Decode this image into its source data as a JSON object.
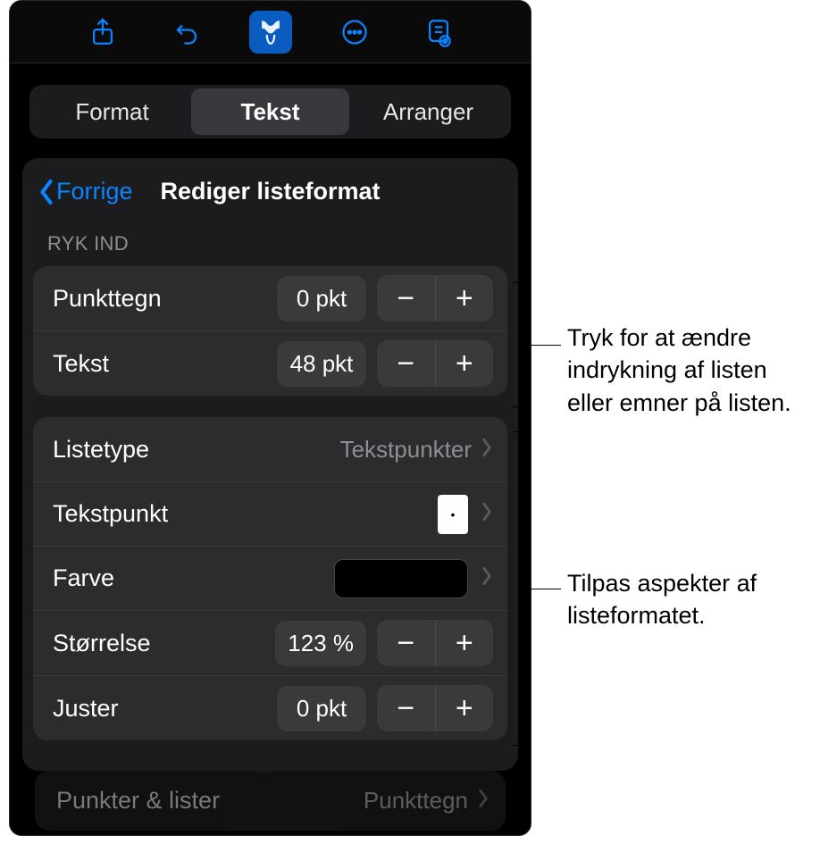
{
  "toolbar": {
    "icons": [
      "share-icon",
      "undo-icon",
      "format-icon",
      "more-icon",
      "presenter-icon"
    ]
  },
  "segments": {
    "items": [
      "Format",
      "Tekst",
      "Arranger"
    ],
    "selected": 1
  },
  "panel": {
    "back_label": "Forrige",
    "title": "Rediger listeformat",
    "indent": {
      "header": "RYK IND",
      "rows": {
        "bullet": {
          "label": "Punkttegn",
          "value": "0 pkt"
        },
        "text": {
          "label": "Tekst",
          "value": "48 pkt"
        }
      }
    },
    "customize": {
      "listtype": {
        "label": "Listetype",
        "value": "Tekstpunkter"
      },
      "textpoint": {
        "label": "Tekstpunkt",
        "glyph": "•"
      },
      "color": {
        "label": "Farve",
        "hex": "#000000"
      },
      "size": {
        "label": "Størrelse",
        "value": "123 %"
      },
      "align": {
        "label": "Juster",
        "value": "0 pkt"
      }
    }
  },
  "below": {
    "label": "Punkter & lister",
    "value": "Punkttegn"
  },
  "callouts": {
    "indent": "Tryk for at ændre indrykning af listen eller emner på listen.",
    "custom": "Tilpas aspekter af listeformatet."
  }
}
